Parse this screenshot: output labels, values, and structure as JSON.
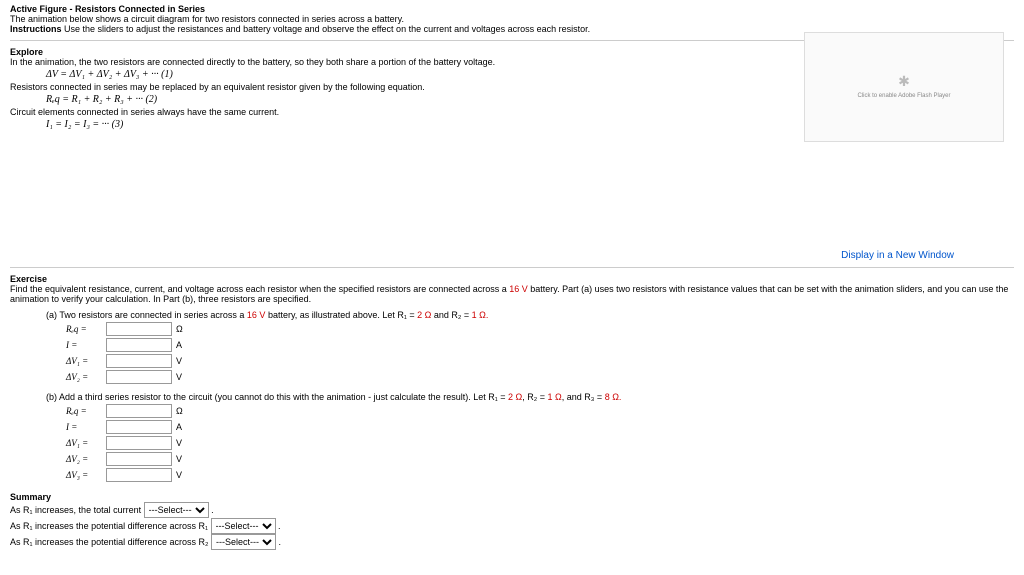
{
  "header": {
    "title": "Active Figure - Resistors Connected in Series",
    "desc": "The animation below shows a circuit diagram for two resistors connected in series across a battery.",
    "instr_label": "Instructions",
    "instr_text": "Use the sliders to adjust the resistances and battery voltage and observe the effect on the current and voltages across each resistor."
  },
  "explore": {
    "heading": "Explore",
    "line1": "In the animation, the two resistors are connected directly to the battery, so they both share a portion of the battery voltage.",
    "eq1": "ΔV = ΔV₁ + ΔV₂ + ΔV₃ + ··· (1)",
    "line2": "Resistors connected in series may be replaced by an equivalent resistor given by the following equation.",
    "eq2": "Rₑq = R₁ + R₂ + R₃ + ··· (2)",
    "line3": "Circuit elements connected in series always have the same current.",
    "eq3": "I₁ = I₂ = I₃ = ··· (3)"
  },
  "flash": {
    "msg": "Click to enable Adobe Flash Player"
  },
  "display_link": "Display in a New Window",
  "exercise": {
    "heading": "Exercise",
    "intro_a": "Find the equivalent resistance, current, and voltage across each resistor when the specified resistors are connected across a ",
    "volt": "16 V",
    "intro_b": " battery. Part (a) uses two resistors with resistance values that can be set with the animation sliders, and you can use the animation to verify your calculation. In Part (b), three resistors are specified.",
    "part_a": {
      "text_a": "(a) Two resistors are connected in series across a ",
      "volt": "16 V",
      "text_b": " battery, as illustrated above. Let R₁ = ",
      "r1": "2 Ω",
      "text_c": " and R₂ = ",
      "r2": "1 Ω.",
      "rows": [
        {
          "label": "Rₑq =",
          "unit": "Ω"
        },
        {
          "label": "I =",
          "unit": "A"
        },
        {
          "label": "ΔV₁ =",
          "unit": "V"
        },
        {
          "label": "ΔV₂ =",
          "unit": "V"
        }
      ]
    },
    "part_b": {
      "text_a": "(b) Add a third series resistor to the circuit (you cannot do this with the animation - just calculate the result). Let R₁ = ",
      "r1": "2 Ω",
      "text_b": ", R₂ = ",
      "r2": "1 Ω",
      "text_c": ", and R₃ = ",
      "r3": "8 Ω.",
      "rows": [
        {
          "label": "Rₑq =",
          "unit": "Ω"
        },
        {
          "label": "I =",
          "unit": "A"
        },
        {
          "label": "ΔV₁ =",
          "unit": "V"
        },
        {
          "label": "ΔV₂ =",
          "unit": "V"
        },
        {
          "label": "ΔV₃ =",
          "unit": "V"
        }
      ]
    }
  },
  "summary": {
    "heading": "Summary",
    "line1_a": "As R₁ increases, the total current ",
    "line2_a": "As R₁ increases the potential difference across R₁ ",
    "line3_a": "As R₁ increases the potential difference across R₂ ",
    "select_placeholder": "---Select---",
    "after": " ."
  }
}
